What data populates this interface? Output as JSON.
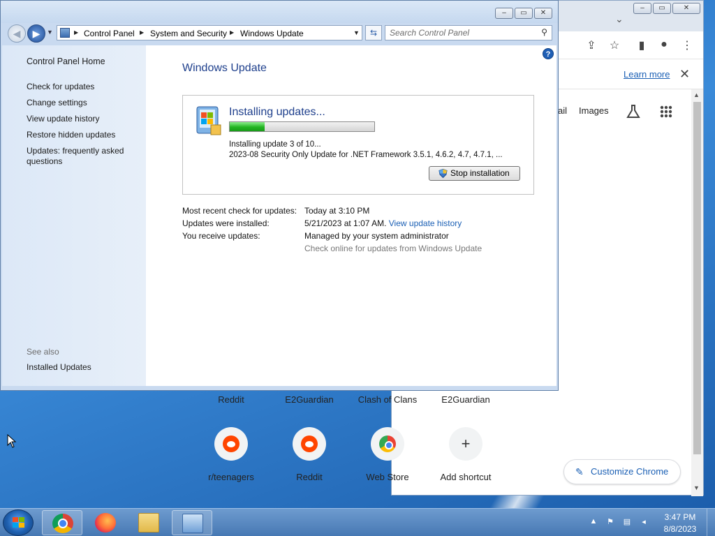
{
  "control_panel": {
    "caption": {
      "minimize": "–",
      "restore": "▭",
      "close": "✕"
    },
    "breadcrumb": [
      "Control Panel",
      "System and Security",
      "Windows Update"
    ],
    "search_placeholder": "Search Control Panel",
    "sidebar": {
      "home": "Control Panel Home",
      "links": [
        "Check for updates",
        "Change settings",
        "View update history",
        "Restore hidden updates",
        "Updates: frequently asked questions"
      ],
      "see_also": "See also",
      "installed_updates": "Installed Updates"
    },
    "help_glyph": "?",
    "heading": "Windows Update",
    "status": {
      "title": "Installing updates...",
      "progress_fraction": 0.24,
      "line1": "Installing update 3 of 10...",
      "line2": "2023-08 Security Only Update for .NET Framework 3.5.1, 4.6.2, 4.7, 4.7.1, ...",
      "stop_button": "Stop installation"
    },
    "info": {
      "recent_label": "Most recent check for updates:",
      "recent_value": "Today at 3:10 PM",
      "installed_label": "Updates were installed:",
      "installed_value": "5/21/2023 at 1:07 AM.",
      "installed_link": "View update history",
      "receive_label": "You receive updates:",
      "receive_value": "Managed by your system administrator",
      "check_online": "Check online for updates from Windows Update"
    }
  },
  "chrome": {
    "learn_more": "Learn more",
    "info_close": "✕",
    "links": {
      "gmail_partial": "ail",
      "images": "Images"
    },
    "shortcut_titles_top": [
      "Reddit",
      "E2Guardian",
      "Clash of Clans",
      "E2Guardian"
    ],
    "shortcuts": [
      {
        "label": "r/teenagers",
        "icon": "reddit-icon"
      },
      {
        "label": "Reddit",
        "icon": "reddit-icon"
      },
      {
        "label": "Web Store",
        "icon": "web-store-icon"
      },
      {
        "label": "Add shortcut",
        "icon": "add-icon"
      }
    ],
    "add_glyph": "+",
    "customize": "Customize Chrome"
  },
  "taskbar": {
    "apps": [
      "chrome-icon",
      "firefox-icon",
      "file-explorer-icon",
      "control-panel-icon"
    ],
    "clock_time": "3:47 PM",
    "clock_date": "8/8/2023"
  }
}
